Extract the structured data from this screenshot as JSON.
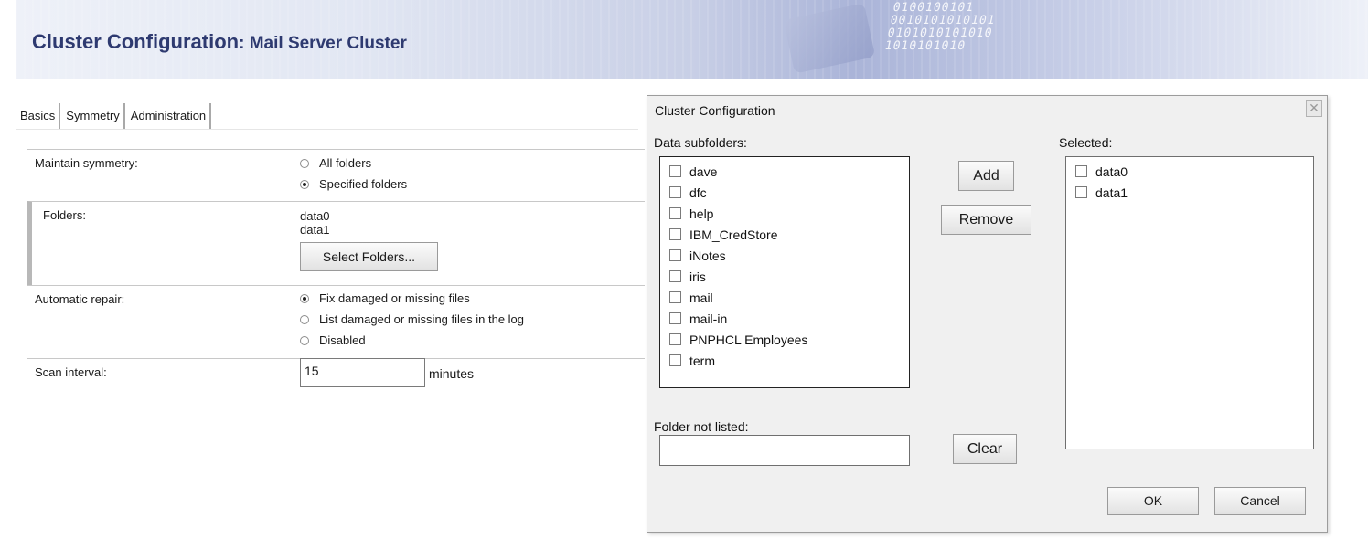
{
  "banner": {
    "title": "Cluster Configuration",
    "subtitle": ": Mail Server Cluster",
    "bits_line1": "0100100101",
    "bits_line2": "0010101010101",
    "bits_line3": "0101010101010",
    "bits_line4": "1010101010"
  },
  "tabs": [
    {
      "label": "Basics"
    },
    {
      "label": "Symmetry"
    },
    {
      "label": "Administration"
    }
  ],
  "form": {
    "maintain_symmetry": {
      "label": "Maintain symmetry:",
      "options": [
        "All folders",
        "Specified folders"
      ],
      "selected": "Specified folders"
    },
    "folders": {
      "label": "Folders:",
      "values": [
        "data0",
        "data1"
      ],
      "button": "Select Folders..."
    },
    "automatic_repair": {
      "label": "Automatic repair:",
      "options": [
        "Fix damaged or missing files",
        "List damaged or missing files in the log",
        "Disabled"
      ],
      "selected": "Fix damaged or missing files"
    },
    "scan_interval": {
      "label": "Scan interval:",
      "value": "15",
      "unit": "minutes"
    }
  },
  "dialog": {
    "title": "Cluster Configuration",
    "close_glyph": "✕",
    "data_subfolders_label": "Data subfolders:",
    "data_subfolders": [
      "dave",
      "dfc",
      "help",
      "IBM_CredStore",
      "iNotes",
      "iris",
      "mail",
      "mail-in",
      "PNPHCL Employees",
      "term"
    ],
    "selected_label": "Selected:",
    "selected": [
      "data0",
      "data1"
    ],
    "add_button": "Add",
    "remove_button": "Remove",
    "folder_not_listed_label": "Folder not listed:",
    "folder_not_listed_value": "",
    "clear_button": "Clear",
    "ok_button": "OK",
    "cancel_button": "Cancel"
  }
}
